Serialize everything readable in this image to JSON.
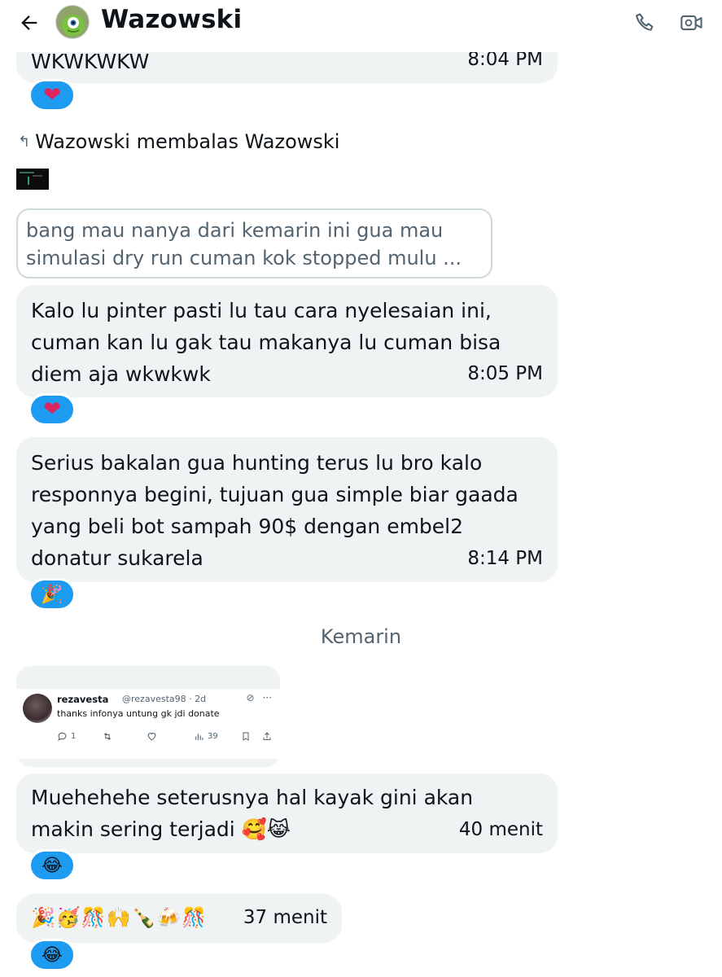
{
  "header": {
    "back_icon": "arrow-left-icon",
    "title": "Wazowski",
    "call_icon": "phone-icon",
    "video_icon": "video-camera-icon"
  },
  "messages": [
    {
      "text": "WKWKWKW",
      "time": "8:04 PM",
      "reaction": "❤"
    },
    {
      "reply_header": "Wazowski membalas Wazowski",
      "quoted_text": "bang mau nanya dari kemarin ini gua mau\nsimulasi dry run cuman kok stopped mulu ...",
      "text": "Kalo lu pinter pasti lu tau cara nyelesaian ini,\ncuman kan lu gak tau makanya lu cuman bisa\ndiem aja wkwkwk",
      "time": "8:05 PM",
      "reaction": "❤"
    },
    {
      "text": "Serius bakalan gua hunting terus lu bro kalo\nresponnya begini, tujuan gua simple biar gaada\nyang beli bot sampah 90$ dengan embel2\ndonatur sukarela",
      "time": "8:14 PM",
      "reaction": "🎉"
    },
    {
      "text": "Muehehehe seterusnya hal kayak gini akan\nmakin sering terjadi 🥰😹",
      "time": "40 menit",
      "reaction": "😂"
    },
    {
      "text": "🎉🥳🎊🙌🍾🍻🎊",
      "time": "37 menit",
      "reaction": "😂"
    }
  ],
  "day_separator": "Kemarin",
  "tweet_card": {
    "name": "rezavesta",
    "handle": "@rezavesta98 · 2d",
    "text": "thanks infonya untung gk jdi donate",
    "reply_count": "1",
    "views": "39"
  },
  "colors": {
    "bubble_bg": "#eff3f4",
    "reaction_bg": "#1d9bf0",
    "text": "#0f1419",
    "muted": "#536471"
  }
}
